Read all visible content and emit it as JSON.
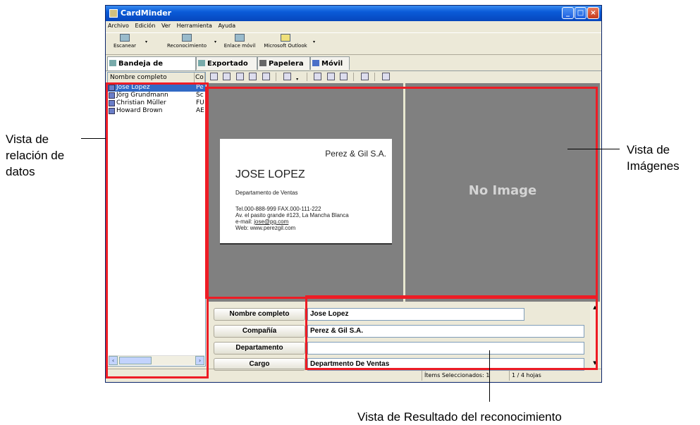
{
  "window": {
    "title": "CardMinder"
  },
  "menu": [
    "Archivo",
    "Edición",
    "Ver",
    "Herramienta",
    "Ayuda"
  ],
  "toolbar": [
    {
      "label": "Escanear",
      "icon": "scanner-icon"
    },
    {
      "label": "Reconocimiento",
      "icon": "recognition-icon"
    },
    {
      "label": "Enlace móvil",
      "icon": "mobile-link-icon"
    },
    {
      "label": "Microsoft Outlook",
      "icon": "outlook-icon"
    }
  ],
  "tabs": [
    {
      "label": "Bandeja de entrada",
      "icon": "inbox-icon",
      "active": true
    },
    {
      "label": "Exportado",
      "icon": "export-icon"
    },
    {
      "label": "Papelera",
      "icon": "trash-icon"
    },
    {
      "label": "Móvil",
      "icon": "mobile-icon"
    }
  ],
  "list": {
    "columns": [
      "Nombre completo",
      "Co"
    ],
    "rows": [
      {
        "name": "Jose Lopez",
        "company": "Pe",
        "selected": true
      },
      {
        "name": "Jörg Grundmann",
        "company": "Sc"
      },
      {
        "name": "Christian Müller",
        "company": "FU"
      },
      {
        "name": "Howard Brown",
        "company": "AE"
      }
    ]
  },
  "card": {
    "company": "Perez & Gil S.A.",
    "name": "JOSE LOPEZ",
    "department": "Departamento de Ventas",
    "tel": "Tel.000-888-999   FAX.000-111-222",
    "address": "Av. el pasito grande #123, La Mancha Blanca",
    "email_label": "e-mail: ",
    "email": "jose@pg.com",
    "web": "Web: www.perezgil.com"
  },
  "no_image_text": "No Image",
  "fields": [
    {
      "label": "Nombre completo",
      "value": "Jose Lopez"
    },
    {
      "label": "Compañía",
      "value": "Perez & Gil S.A."
    },
    {
      "label": "Departamento",
      "value": ""
    },
    {
      "label": "Cargo",
      "value": "Departmento De Ventas"
    }
  ],
  "status": {
    "selected": "Ítems Seleccionados:  1",
    "pages": "1 /   4 hojas"
  },
  "annotations": {
    "data_view": [
      "Vista de",
      "relación de",
      "datos"
    ],
    "image_view": [
      "Vista de",
      "Imágenes"
    ],
    "result_view": "Vista de Resultado del reconocimiento"
  }
}
